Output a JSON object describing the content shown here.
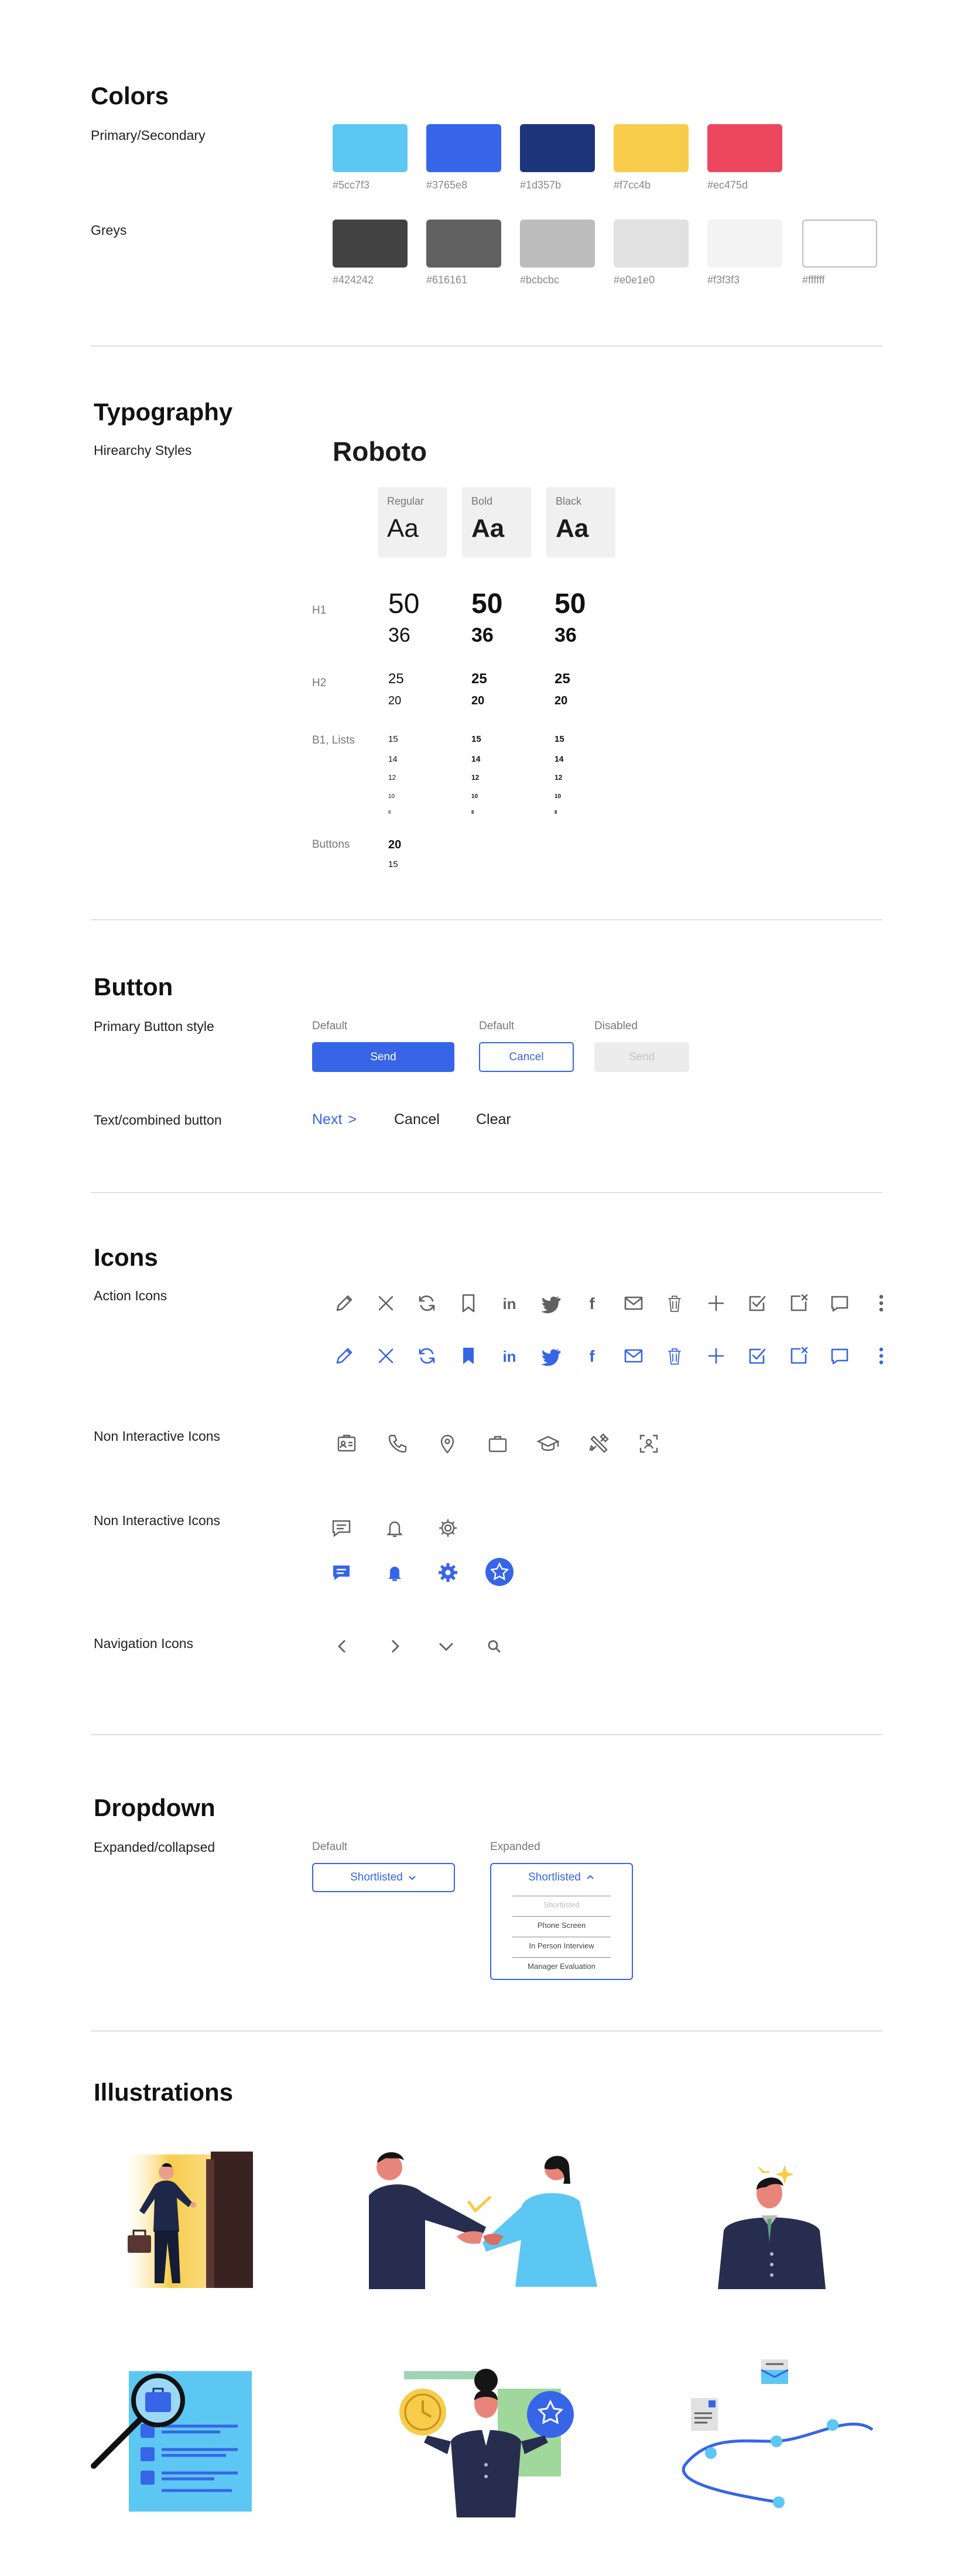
{
  "colors": {
    "title": "Colors",
    "primary_label": "Primary/Secondary",
    "primary": [
      {
        "hex": "#5cc7f3",
        "label": "#5cc7f3"
      },
      {
        "hex": "#3765e8",
        "label": "#3765e8"
      },
      {
        "hex": "#1d357b",
        "label": "#1d357b"
      },
      {
        "hex": "#f7cc4b",
        "label": "#f7cc4b"
      },
      {
        "hex": "#ec475d",
        "label": "#ec475d"
      }
    ],
    "greys_label": "Greys",
    "greys": [
      {
        "hex": "#424242",
        "label": "#424242"
      },
      {
        "hex": "#616161",
        "label": "#616161"
      },
      {
        "hex": "#bcbcbc",
        "label": "#bcbcbc"
      },
      {
        "hex": "#e0e1e0",
        "label": "#e0e1e0"
      },
      {
        "hex": "#f3f3f3",
        "label": "#f3f3f3"
      },
      {
        "hex": "#ffffff",
        "label": "#ffffff"
      }
    ]
  },
  "typography": {
    "title": "Typography",
    "hierarchy_label": "Hirearchy Styles",
    "font_name": "Roboto",
    "weights": [
      {
        "name": "Regular",
        "sample": "Aa"
      },
      {
        "name": "Bold",
        "sample": "Aa"
      },
      {
        "name": "Black",
        "sample": "Aa"
      }
    ],
    "rows": [
      {
        "label": "H1",
        "sizes": [
          "50",
          "36"
        ]
      },
      {
        "label": "H2",
        "sizes": [
          "25",
          "20"
        ]
      },
      {
        "label": "B1, Lists",
        "sizes": [
          "15",
          "14",
          "12",
          "10",
          "8"
        ]
      },
      {
        "label": "Buttons",
        "sizes": [
          "20",
          "15"
        ]
      }
    ]
  },
  "button": {
    "title": "Button",
    "primary_label": "Primary Button style",
    "default_caption": "Default",
    "default_caption_2": "Default",
    "disabled_caption": "Disabled",
    "send_label": "Send",
    "cancel_label": "Cancel",
    "disabled_label": "Send",
    "text_label": "Text/combined button",
    "next_label": "Next",
    "next_arrow": ">",
    "text_cancel": "Cancel",
    "text_clear": "Clear"
  },
  "icons": {
    "title": "Icons",
    "action_label": "Action Icons",
    "non_interactive_label": "Non Interactive Icons",
    "non_interactive_label_2": "Non Interactive Icons",
    "navigation_label": "Navigation Icons",
    "action_icons": [
      "pencil-icon",
      "close-icon",
      "refresh-icon",
      "bookmark-icon",
      "linkedin-icon",
      "twitter-icon",
      "facebook-icon",
      "mail-icon",
      "trash-icon",
      "plus-icon",
      "checkbox-icon",
      "close-box-icon",
      "comment-icon",
      "more-vertical-icon"
    ],
    "grey_color": "#616161",
    "blue_color": "#3765e8"
  },
  "dropdown": {
    "title": "Dropdown",
    "state_label": "Expanded/collapsed",
    "default_caption": "Default",
    "expanded_caption": "Expanded",
    "selected": "Shortlisted",
    "expanded_selected": "Shortlisted",
    "options": [
      "Shortlisted",
      "Phone Screen",
      "In Person Interview",
      "Manager Evaluation"
    ]
  },
  "illustrations": {
    "title": "Illustrations"
  }
}
